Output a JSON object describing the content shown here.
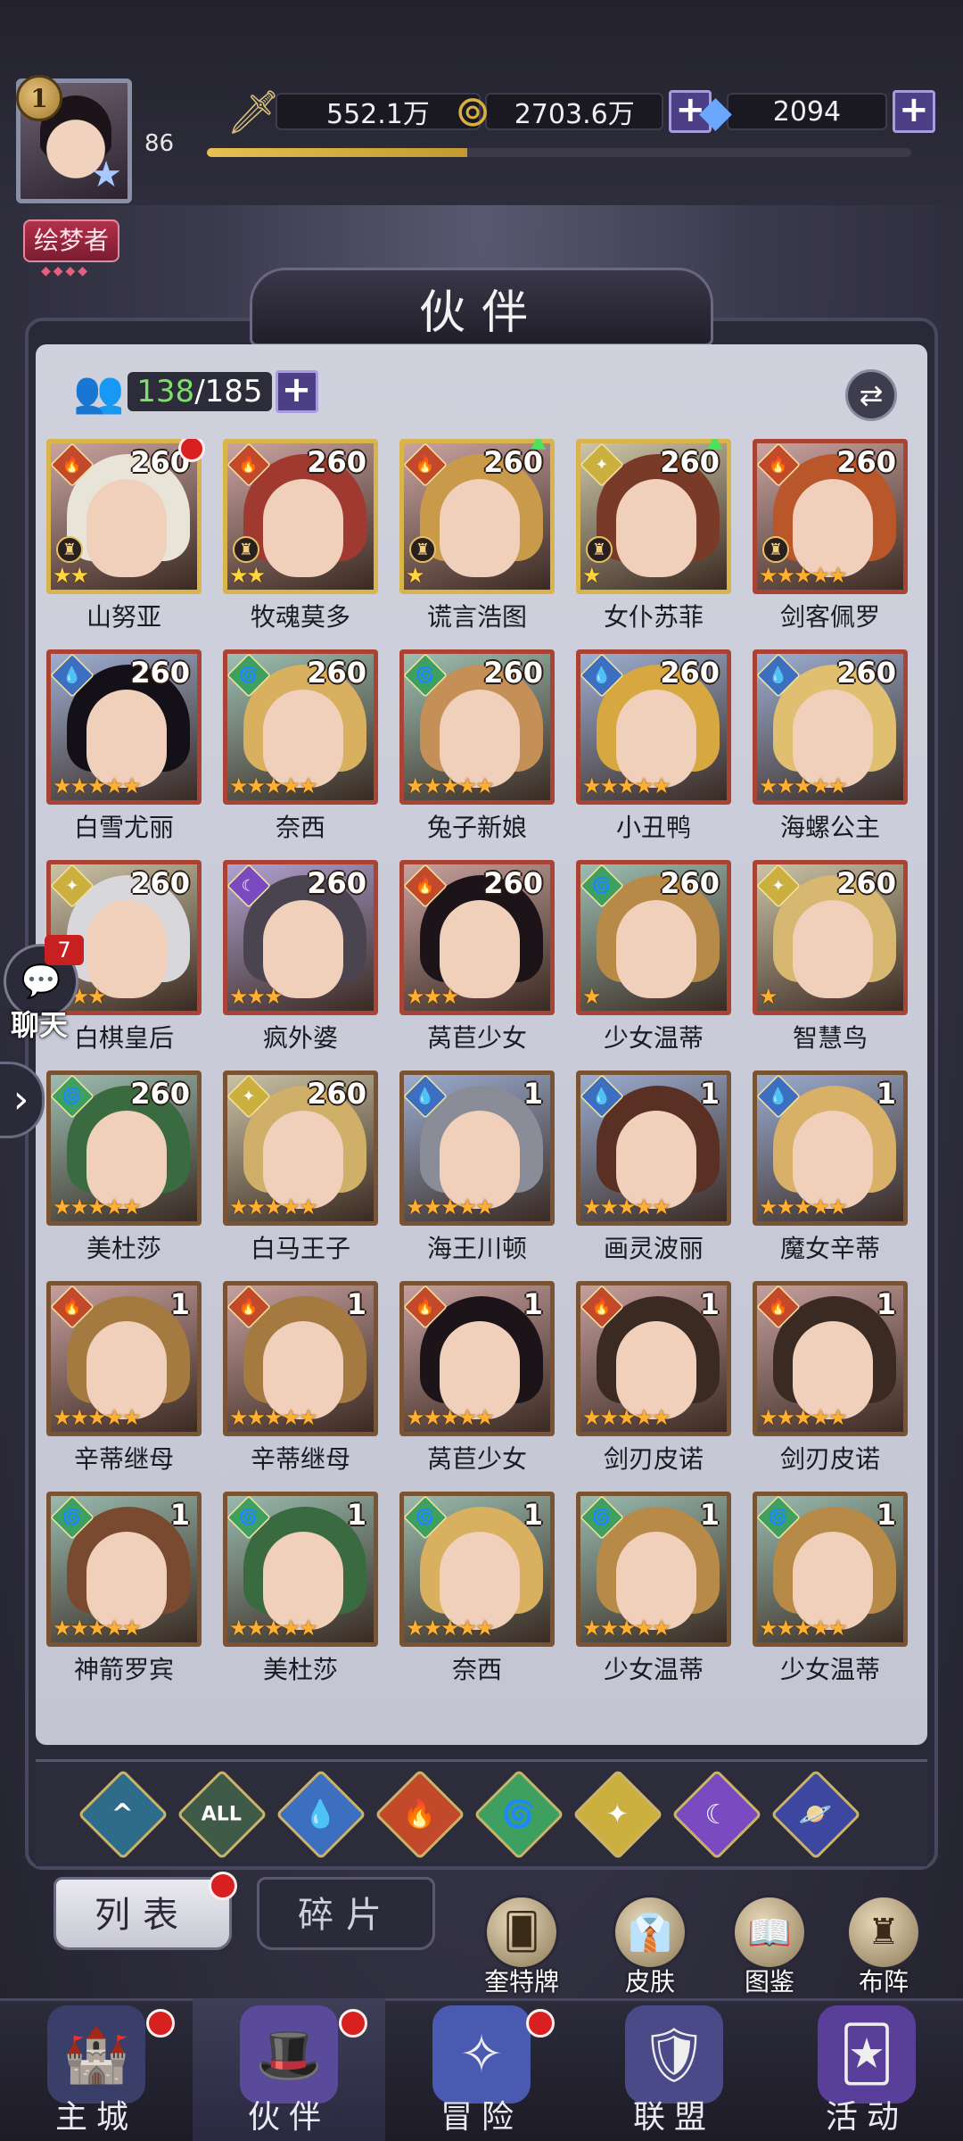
{
  "player": {
    "badge_level": "1",
    "level": "86",
    "title": "绘梦者",
    "xp_fraction": 0.37
  },
  "currencies": {
    "power": "552.1万",
    "gold": "2703.6万",
    "gems": "2094"
  },
  "header": {
    "title": "伙伴"
  },
  "roster": {
    "current": "138",
    "sep_total": "/185"
  },
  "colors": {
    "fire": "#c24a2a",
    "water": "#3d6fc0",
    "wind": "#3ea060",
    "light": "#cbb040",
    "dark": "#7a4ac0"
  },
  "cards": [
    {
      "name": "山努亚",
      "level": "260",
      "element": "fire",
      "stars": 2,
      "star_color": "gold",
      "frame": "gold",
      "rook": true,
      "red_dot": true,
      "up": false,
      "hair": "#e9e4d8"
    },
    {
      "name": "牧魂莫多",
      "level": "260",
      "element": "fire",
      "stars": 2,
      "star_color": "gold",
      "frame": "gold",
      "rook": true,
      "red_dot": false,
      "up": false,
      "hair": "#a03a30"
    },
    {
      "name": "谎言浩图",
      "level": "260",
      "element": "fire",
      "stars": 1,
      "star_color": "gold",
      "frame": "gold",
      "rook": true,
      "red_dot": false,
      "up": true,
      "hair": "#c99a4a"
    },
    {
      "name": "女仆苏菲",
      "level": "260",
      "element": "light",
      "stars": 1,
      "star_color": "gold",
      "frame": "gold",
      "rook": true,
      "red_dot": false,
      "up": true,
      "hair": "#7a3a28"
    },
    {
      "name": "剑客佩罗",
      "level": "260",
      "element": "fire",
      "stars": 5,
      "star_color": "orange",
      "frame": "red",
      "rook": true,
      "red_dot": false,
      "up": false,
      "hair": "#b9562a"
    },
    {
      "name": "白雪尤丽",
      "level": "260",
      "element": "water",
      "stars": 5,
      "star_color": "orange",
      "frame": "red",
      "rook": false,
      "red_dot": false,
      "up": false,
      "hair": "#141018"
    },
    {
      "name": "奈西",
      "level": "260",
      "element": "wind",
      "stars": 5,
      "star_color": "orange",
      "frame": "red",
      "rook": false,
      "red_dot": false,
      "up": false,
      "hair": "#d8b060"
    },
    {
      "name": "兔子新娘",
      "level": "260",
      "element": "wind",
      "stars": 5,
      "star_color": "orange",
      "frame": "red",
      "rook": false,
      "red_dot": false,
      "up": false,
      "hair": "#c49058"
    },
    {
      "name": "小丑鸭",
      "level": "260",
      "element": "water",
      "stars": 5,
      "star_color": "orange",
      "frame": "red",
      "rook": false,
      "red_dot": false,
      "up": false,
      "hair": "#d8a840"
    },
    {
      "name": "海螺公主",
      "level": "260",
      "element": "water",
      "stars": 5,
      "star_color": "orange",
      "frame": "red",
      "rook": false,
      "red_dot": false,
      "up": false,
      "hair": "#e0c070"
    },
    {
      "name": "白棋皇后",
      "level": "260",
      "element": "light",
      "stars": 3,
      "star_color": "orange",
      "frame": "red",
      "rook": false,
      "red_dot": false,
      "up": false,
      "hair": "#d8d8dc"
    },
    {
      "name": "疯外婆",
      "level": "260",
      "element": "dark",
      "stars": 3,
      "star_color": "orange",
      "frame": "red",
      "rook": false,
      "red_dot": false,
      "up": false,
      "hair": "#4a4450"
    },
    {
      "name": "莴苣少女",
      "level": "260",
      "element": "fire",
      "stars": 3,
      "star_color": "orange",
      "frame": "red",
      "rook": false,
      "red_dot": false,
      "up": false,
      "hair": "#1c1418"
    },
    {
      "name": "少女温蒂",
      "level": "260",
      "element": "wind",
      "stars": 1,
      "star_color": "orange",
      "frame": "red",
      "rook": false,
      "red_dot": false,
      "up": false,
      "hair": "#b88a48"
    },
    {
      "name": "智慧鸟",
      "level": "260",
      "element": "light",
      "stars": 1,
      "star_color": "orange",
      "frame": "red",
      "rook": false,
      "red_dot": false,
      "up": false,
      "hair": "#d8b870"
    },
    {
      "name": "美杜莎",
      "level": "260",
      "element": "wind",
      "stars": 5,
      "star_color": "orange",
      "frame": "bronze",
      "rook": false,
      "red_dot": false,
      "up": false,
      "hair": "#3a6a40"
    },
    {
      "name": "白马王子",
      "level": "260",
      "element": "light",
      "stars": 5,
      "star_color": "orange",
      "frame": "bronze",
      "rook": false,
      "red_dot": false,
      "up": false,
      "hair": "#d0b068"
    },
    {
      "name": "海王川顿",
      "level": "1",
      "element": "water",
      "stars": 5,
      "star_color": "orange",
      "frame": "bronze",
      "rook": false,
      "red_dot": false,
      "up": false,
      "hair": "#8a8c98"
    },
    {
      "name": "画灵波丽",
      "level": "1",
      "element": "water",
      "stars": 5,
      "star_color": "orange",
      "frame": "bronze",
      "rook": false,
      "red_dot": false,
      "up": false,
      "hair": "#5a3024"
    },
    {
      "name": "魔女辛蒂",
      "level": "1",
      "element": "water",
      "stars": 5,
      "star_color": "orange",
      "frame": "bronze",
      "rook": false,
      "red_dot": false,
      "up": false,
      "hair": "#d8b068"
    },
    {
      "name": "辛蒂继母",
      "level": "1",
      "element": "fire",
      "stars": 5,
      "star_color": "orange",
      "frame": "bronze",
      "rook": false,
      "red_dot": false,
      "up": false,
      "hair": "#a47a40"
    },
    {
      "name": "辛蒂继母",
      "level": "1",
      "element": "fire",
      "stars": 5,
      "star_color": "orange",
      "frame": "bronze",
      "rook": false,
      "red_dot": false,
      "up": false,
      "hair": "#a47a40"
    },
    {
      "name": "莴苣少女",
      "level": "1",
      "element": "fire",
      "stars": 5,
      "star_color": "orange",
      "frame": "bronze",
      "rook": false,
      "red_dot": false,
      "up": false,
      "hair": "#1c1418"
    },
    {
      "name": "剑刃皮诺",
      "level": "1",
      "element": "fire",
      "stars": 5,
      "star_color": "orange",
      "frame": "bronze",
      "rook": false,
      "red_dot": false,
      "up": false,
      "hair": "#3a2a22"
    },
    {
      "name": "剑刃皮诺",
      "level": "1",
      "element": "fire",
      "stars": 5,
      "star_color": "orange",
      "frame": "bronze",
      "rook": false,
      "red_dot": false,
      "up": false,
      "hair": "#3a2a22"
    },
    {
      "name": "神箭罗宾",
      "level": "1",
      "element": "wind",
      "stars": 5,
      "star_color": "orange",
      "frame": "bronze",
      "rook": false,
      "red_dot": false,
      "up": false,
      "hair": "#7a4a30"
    },
    {
      "name": "美杜莎",
      "level": "1",
      "element": "wind",
      "stars": 5,
      "star_color": "orange",
      "frame": "bronze",
      "rook": false,
      "red_dot": false,
      "up": false,
      "hair": "#3a6a40"
    },
    {
      "name": "奈西",
      "level": "1",
      "element": "wind",
      "stars": 5,
      "star_color": "orange",
      "frame": "bronze",
      "rook": false,
      "red_dot": false,
      "up": false,
      "hair": "#d8b060"
    },
    {
      "name": "少女温蒂",
      "level": "1",
      "element": "wind",
      "stars": 5,
      "star_color": "orange",
      "frame": "bronze",
      "rook": false,
      "red_dot": false,
      "up": false,
      "hair": "#b88a48"
    },
    {
      "name": "少女温蒂",
      "level": "1",
      "element": "wind",
      "stars": 5,
      "star_color": "orange",
      "frame": "bronze",
      "rook": false,
      "red_dot": false,
      "up": false,
      "hair": "#b88a48"
    }
  ],
  "filters": [
    {
      "icon": "camp-icon",
      "label": "^"
    },
    {
      "icon": "all-icon",
      "label": "ALL"
    },
    {
      "icon": "water-icon",
      "label": "💧"
    },
    {
      "icon": "fire-icon",
      "label": "🔥"
    },
    {
      "icon": "wind-icon",
      "label": "🌀"
    },
    {
      "icon": "light-icon",
      "label": "✦"
    },
    {
      "icon": "dark-icon",
      "label": "☾"
    },
    {
      "icon": "cosmos-icon",
      "label": "🪐"
    }
  ],
  "tabs": {
    "list": "列表",
    "fragments": "碎片"
  },
  "quick": {
    "cards": "奎特牌",
    "skins": "皮肤",
    "codex": "图鉴",
    "formation": "布阵"
  },
  "chat": {
    "count": "7",
    "label": "聊天"
  },
  "nav": {
    "town": "主城",
    "partners": "伙伴",
    "adventure": "冒险",
    "alliance": "联盟",
    "events": "活动"
  }
}
